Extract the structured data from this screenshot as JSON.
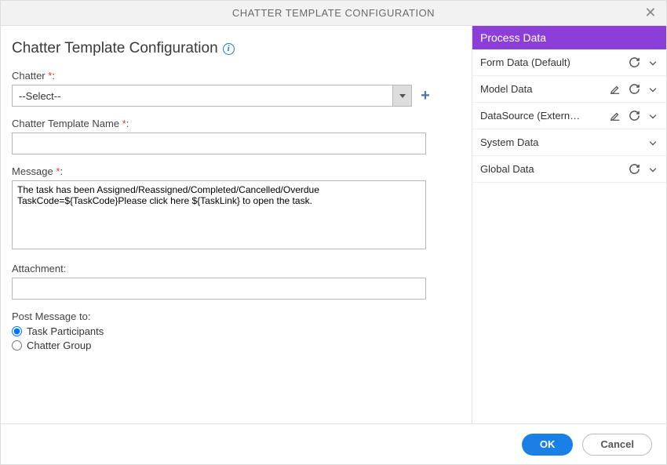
{
  "titlebar": {
    "title": "CHATTER TEMPLATE CONFIGURATION"
  },
  "page": {
    "heading": "Chatter Template Configuration"
  },
  "fields": {
    "chatter": {
      "label": "Chatter",
      "required": "*",
      "selected": "--Select--"
    },
    "template_name": {
      "label": "Chatter Template Name",
      "required": "*",
      "value": ""
    },
    "message": {
      "label": "Message",
      "required": "*",
      "value": "The task has been Assigned/Reassigned/Completed/Cancelled/Overdue TaskCode=${TaskCode}Please click here ${TaskLink} to open the task."
    },
    "attachment": {
      "label": "Attachment:",
      "value": ""
    },
    "post_to": {
      "label": "Post Message to:",
      "options": [
        {
          "label": "Task Participants",
          "checked": true
        },
        {
          "label": "Chatter Group",
          "checked": false
        }
      ]
    }
  },
  "process_data": {
    "header": "Process Data",
    "items": [
      {
        "label": "Form Data (Default)",
        "edit": false,
        "refresh": true
      },
      {
        "label": "Model Data",
        "edit": true,
        "refresh": true
      },
      {
        "label": "DataSource (Extern…",
        "edit": true,
        "refresh": true
      },
      {
        "label": "System Data",
        "edit": false,
        "refresh": false
      },
      {
        "label": "Global Data",
        "edit": false,
        "refresh": true
      }
    ]
  },
  "footer": {
    "ok": "OK",
    "cancel": "Cancel"
  }
}
